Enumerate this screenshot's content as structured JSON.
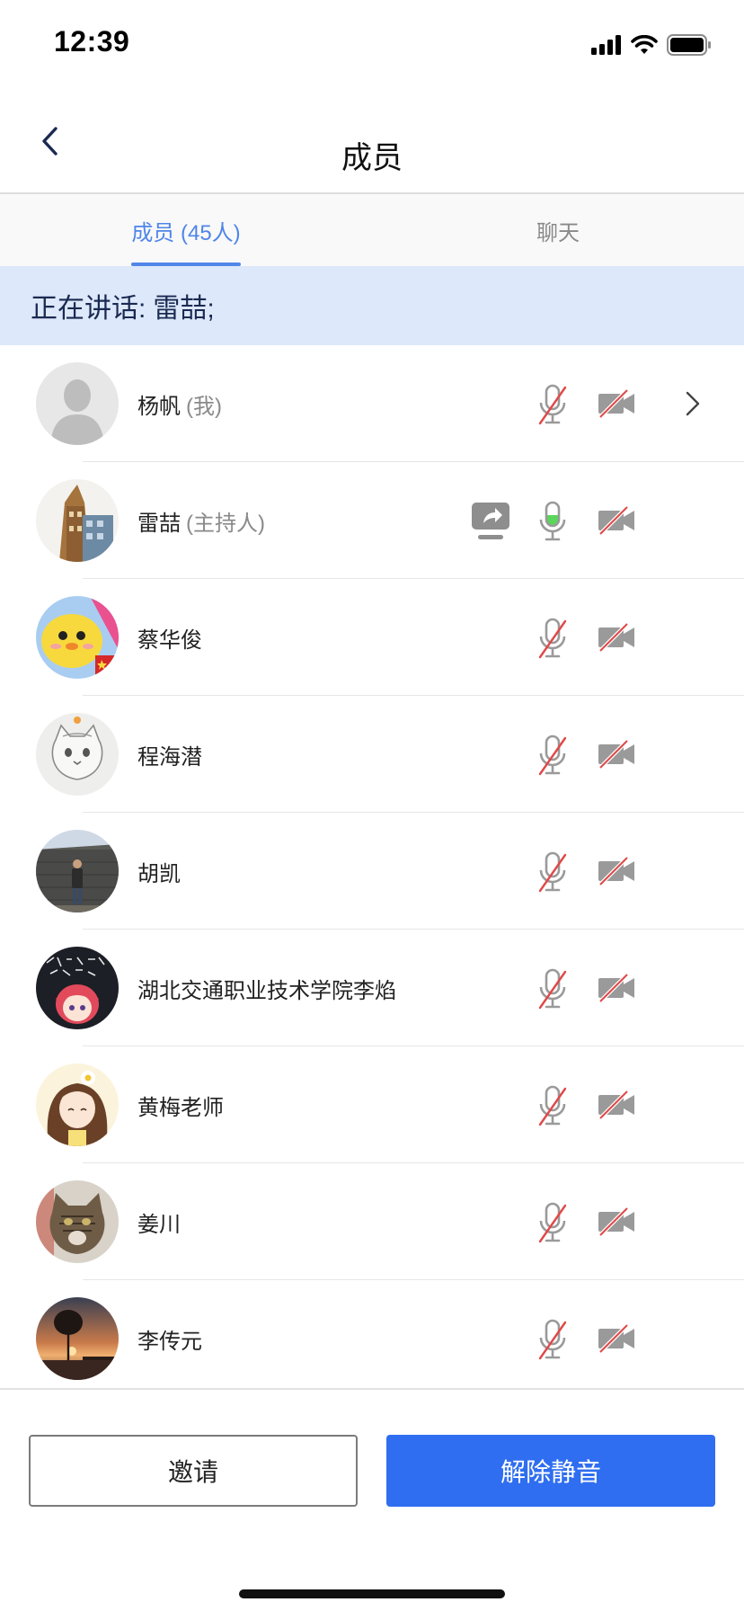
{
  "status_bar": {
    "time": "12:39",
    "icons": [
      "signal-icon",
      "wifi-icon",
      "battery-icon"
    ]
  },
  "nav": {
    "title": "成员",
    "back_icon": "back-arrow-icon"
  },
  "tabs": [
    {
      "label": "成员 (45人)",
      "active": true
    },
    {
      "label": "聊天",
      "active": false
    }
  ],
  "speaking": {
    "label": "正在讲话:",
    "speaker": "雷喆;"
  },
  "members": [
    {
      "name": "杨帆",
      "tag": "(我)",
      "avatar": "default-avatar",
      "sharing": false,
      "mic": "muted",
      "camera": "off",
      "has_chevron": true
    },
    {
      "name": "雷喆",
      "tag": "(主持人)",
      "avatar": "building-photo-avatar",
      "sharing": true,
      "mic": "active",
      "camera": "off",
      "has_chevron": false
    },
    {
      "name": "蔡华俊",
      "tag": "",
      "avatar": "cartoon-chick-avatar",
      "sharing": false,
      "mic": "muted",
      "camera": "off",
      "has_chevron": false
    },
    {
      "name": "程海潜",
      "tag": "",
      "avatar": "cat-sketch-avatar",
      "sharing": false,
      "mic": "muted",
      "camera": "off",
      "has_chevron": false
    },
    {
      "name": "胡凯",
      "tag": "",
      "avatar": "person-wall-photo-avatar",
      "sharing": false,
      "mic": "muted",
      "camera": "off",
      "has_chevron": false
    },
    {
      "name": "湖北交通职业技术学院李焰",
      "tag": "",
      "avatar": "anime-girl-avatar",
      "sharing": false,
      "mic": "muted",
      "camera": "off",
      "has_chevron": false
    },
    {
      "name": "黄梅老师",
      "tag": "",
      "avatar": "cartoon-girl-avatar",
      "sharing": false,
      "mic": "muted",
      "camera": "off",
      "has_chevron": false
    },
    {
      "name": "姜川",
      "tag": "",
      "avatar": "cat-photo-avatar",
      "sharing": false,
      "mic": "muted",
      "camera": "off",
      "has_chevron": false
    },
    {
      "name": "李传元",
      "tag": "",
      "avatar": "sunset-photo-avatar",
      "sharing": false,
      "mic": "muted",
      "camera": "off",
      "has_chevron": false
    }
  ],
  "buttons": {
    "invite": "邀请",
    "unmute": "解除静音"
  },
  "colors": {
    "accent": "#2f6ef0",
    "tab_active": "#4f86e8",
    "speaking_bg": "#dde8fa",
    "mic_active": "#5ad65a",
    "muted_slash": "#e04848"
  }
}
